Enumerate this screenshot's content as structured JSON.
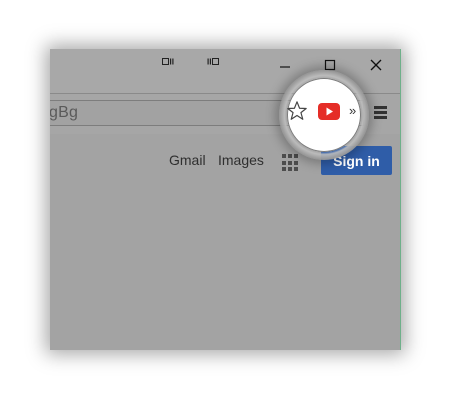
{
  "window": {
    "title_glyphs": [
      "window-left-icon",
      "window-right-icon"
    ],
    "controls": {
      "minimize_icon": "minimize-icon",
      "maximize_icon": "maximize-icon",
      "close_icon": "close-icon"
    }
  },
  "toolbar": {
    "omnibox_text": "gBg",
    "bookmark_icon": "star-icon",
    "extension_icon": "youtube-icon",
    "overflow_label": "»",
    "menu_icon": "hamburger-menu-icon"
  },
  "header_links": {
    "gmail": "Gmail",
    "images": "Images",
    "apps_icon": "apps-grid-icon",
    "signin": "Sign in"
  },
  "colors": {
    "signin_bg": "#2f5da8",
    "youtube_red": "#e52d27",
    "dim_overlay": "#a3a3a3"
  }
}
